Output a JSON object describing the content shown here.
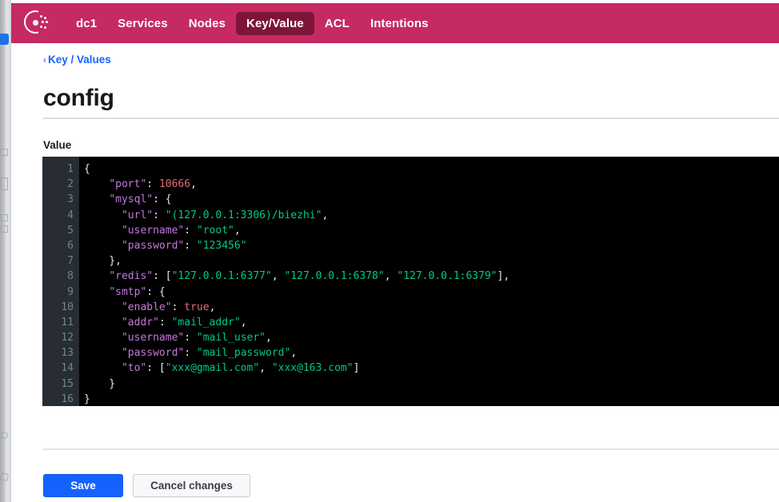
{
  "navbar": {
    "logo_icon": "consul-logo-icon",
    "background_color": "#c62a62",
    "active_background_color": "#7d1538",
    "items": [
      {
        "label": "dc1",
        "active": false
      },
      {
        "label": "Services",
        "active": false
      },
      {
        "label": "Nodes",
        "active": false
      },
      {
        "label": "Key/Value",
        "active": true
      },
      {
        "label": "ACL",
        "active": false
      },
      {
        "label": "Intentions",
        "active": false
      }
    ]
  },
  "breadcrumb": {
    "chevron_icon": "chevron-left-icon",
    "label": "Key / Values",
    "link_color": "#1563ff"
  },
  "page": {
    "title": "config",
    "value_label": "Value"
  },
  "editor": {
    "background_color": "#000000",
    "gutter_color": "#282c34",
    "line_number_color": "#6b8a85",
    "token_colors": {
      "key": "#c678dd",
      "string": "#00c88c",
      "number": "#e06c75",
      "boolean": "#e06c75",
      "punctuation": "#e6e6e6"
    },
    "line_count": 16,
    "lines": [
      {
        "n": "1",
        "tokens": [
          {
            "t": "punc",
            "v": "{"
          }
        ]
      },
      {
        "n": "2",
        "tokens": [
          {
            "t": "punc",
            "v": "    "
          },
          {
            "t": "key",
            "v": "\"port\""
          },
          {
            "t": "punc",
            "v": ": "
          },
          {
            "t": "num",
            "v": "10666"
          },
          {
            "t": "punc",
            "v": ","
          }
        ]
      },
      {
        "n": "3",
        "tokens": [
          {
            "t": "punc",
            "v": "    "
          },
          {
            "t": "key",
            "v": "\"mysql\""
          },
          {
            "t": "punc",
            "v": ": {"
          }
        ]
      },
      {
        "n": "4",
        "tokens": [
          {
            "t": "punc",
            "v": "      "
          },
          {
            "t": "key",
            "v": "\"url\""
          },
          {
            "t": "punc",
            "v": ": "
          },
          {
            "t": "str",
            "v": "\"(127.0.0.1:3306)/biezhi\""
          },
          {
            "t": "punc",
            "v": ","
          }
        ]
      },
      {
        "n": "5",
        "tokens": [
          {
            "t": "punc",
            "v": "      "
          },
          {
            "t": "key",
            "v": "\"username\""
          },
          {
            "t": "punc",
            "v": ": "
          },
          {
            "t": "str",
            "v": "\"root\""
          },
          {
            "t": "punc",
            "v": ","
          }
        ]
      },
      {
        "n": "6",
        "tokens": [
          {
            "t": "punc",
            "v": "      "
          },
          {
            "t": "key",
            "v": "\"password\""
          },
          {
            "t": "punc",
            "v": ": "
          },
          {
            "t": "str",
            "v": "\"123456\""
          }
        ]
      },
      {
        "n": "7",
        "tokens": [
          {
            "t": "punc",
            "v": "    },"
          }
        ]
      },
      {
        "n": "8",
        "tokens": [
          {
            "t": "punc",
            "v": "    "
          },
          {
            "t": "key",
            "v": "\"redis\""
          },
          {
            "t": "punc",
            "v": ": ["
          },
          {
            "t": "str",
            "v": "\"127.0.0.1:6377\""
          },
          {
            "t": "punc",
            "v": ", "
          },
          {
            "t": "str",
            "v": "\"127.0.0.1:6378\""
          },
          {
            "t": "punc",
            "v": ", "
          },
          {
            "t": "str",
            "v": "\"127.0.0.1:6379\""
          },
          {
            "t": "punc",
            "v": "],"
          }
        ]
      },
      {
        "n": "9",
        "tokens": [
          {
            "t": "punc",
            "v": "    "
          },
          {
            "t": "key",
            "v": "\"smtp\""
          },
          {
            "t": "punc",
            "v": ": {"
          }
        ]
      },
      {
        "n": "10",
        "tokens": [
          {
            "t": "punc",
            "v": "      "
          },
          {
            "t": "key",
            "v": "\"enable\""
          },
          {
            "t": "punc",
            "v": ": "
          },
          {
            "t": "bool",
            "v": "true"
          },
          {
            "t": "punc",
            "v": ","
          }
        ]
      },
      {
        "n": "11",
        "tokens": [
          {
            "t": "punc",
            "v": "      "
          },
          {
            "t": "key",
            "v": "\"addr\""
          },
          {
            "t": "punc",
            "v": ": "
          },
          {
            "t": "str",
            "v": "\"mail_addr\""
          },
          {
            "t": "punc",
            "v": ","
          }
        ]
      },
      {
        "n": "12",
        "tokens": [
          {
            "t": "punc",
            "v": "      "
          },
          {
            "t": "key",
            "v": "\"username\""
          },
          {
            "t": "punc",
            "v": ": "
          },
          {
            "t": "str",
            "v": "\"mail_user\""
          },
          {
            "t": "punc",
            "v": ","
          }
        ]
      },
      {
        "n": "13",
        "tokens": [
          {
            "t": "punc",
            "v": "      "
          },
          {
            "t": "key",
            "v": "\"password\""
          },
          {
            "t": "punc",
            "v": ": "
          },
          {
            "t": "str",
            "v": "\"mail_password\""
          },
          {
            "t": "punc",
            "v": ","
          }
        ]
      },
      {
        "n": "14",
        "tokens": [
          {
            "t": "punc",
            "v": "      "
          },
          {
            "t": "key",
            "v": "\"to\""
          },
          {
            "t": "punc",
            "v": ": ["
          },
          {
            "t": "str",
            "v": "\"xxx@gmail.com\""
          },
          {
            "t": "punc",
            "v": ", "
          },
          {
            "t": "str",
            "v": "\"xxx@163.com\""
          },
          {
            "t": "punc",
            "v": "]"
          }
        ]
      },
      {
        "n": "15",
        "tokens": [
          {
            "t": "punc",
            "v": "    }"
          }
        ]
      },
      {
        "n": "16",
        "tokens": [
          {
            "t": "punc",
            "v": "}"
          }
        ]
      }
    ]
  },
  "actions": {
    "save_label": "Save",
    "cancel_label": "Cancel changes",
    "primary_color": "#1563ff"
  }
}
